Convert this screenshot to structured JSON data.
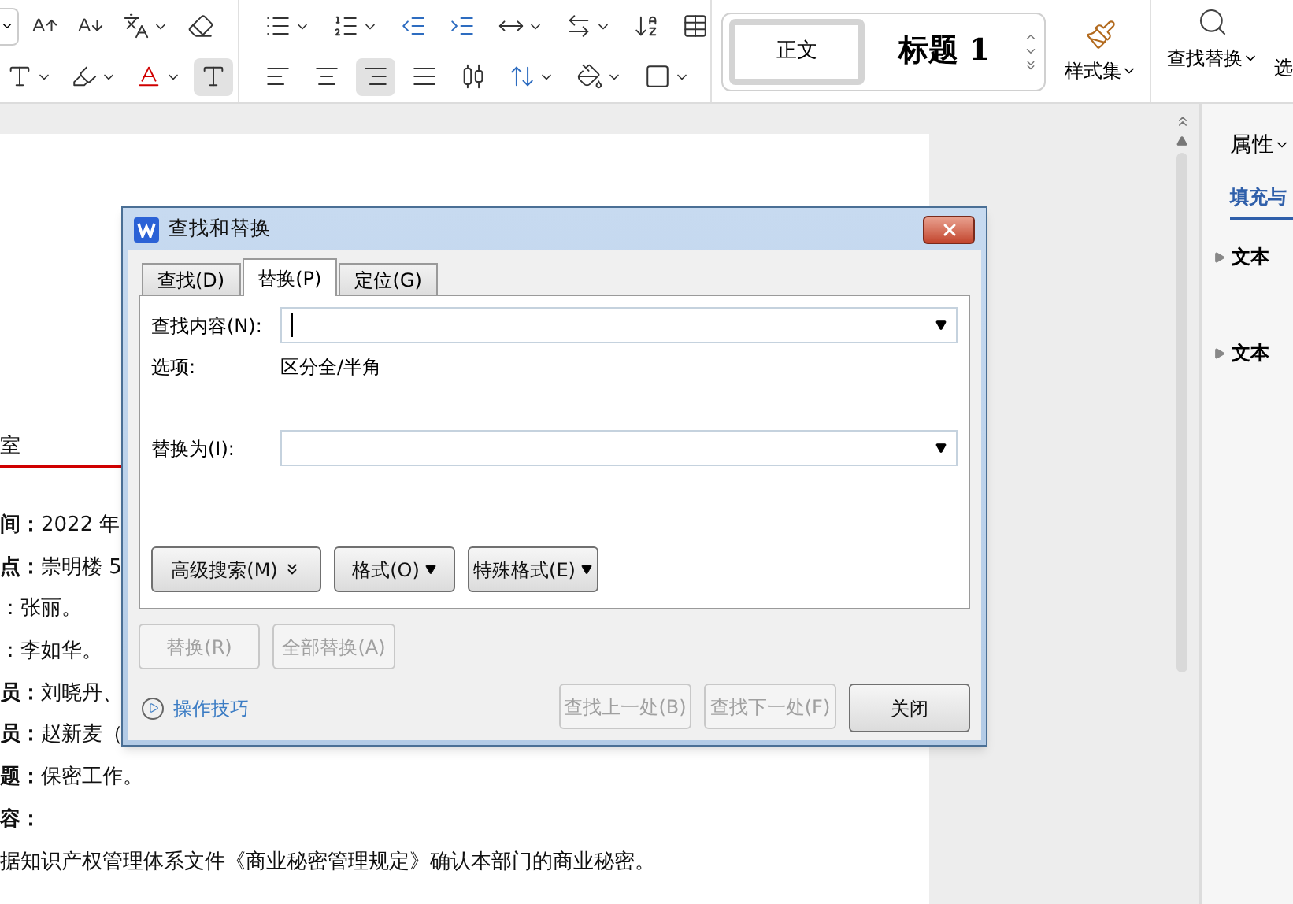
{
  "ribbon": {
    "style_gallery": [
      {
        "label": "正文",
        "selected": true
      },
      {
        "label": "标题 1",
        "selected": false
      }
    ],
    "style_set": "样式集",
    "find_replace": "查找替换",
    "next_tool": "选"
  },
  "document": {
    "heading": "室",
    "lines": [
      "**间：**2022 年",
      "**点：**崇明楼 5",
      "：张丽。",
      "：李如华。",
      "**员：**刘晓丹、",
      "**员：**赵新麦（",
      "**题：**保密工作。",
      "**容：**",
      "据知识产权管理体系文件《商业秘密管理规定》确认本部门的商业秘密。"
    ]
  },
  "dialog": {
    "title": "查找和替换",
    "tabs": [
      {
        "label": "查找(D)",
        "selected": false
      },
      {
        "label": "替换(P)",
        "selected": true
      },
      {
        "label": "定位(G)",
        "selected": false
      }
    ],
    "find_field": {
      "label": "查找内容(N):",
      "focused": true
    },
    "options_label": "选项:",
    "options_value": "区分全/半角",
    "replace_field": {
      "label": "替换为(I):",
      "focused": false
    },
    "panel_buttons": [
      {
        "label": "高级搜索(M)",
        "kind": "expand"
      },
      {
        "label": "格式(O)",
        "kind": "menu"
      },
      {
        "label": "特殊格式(E)",
        "kind": "menu"
      }
    ],
    "action_buttons": [
      {
        "label": "替换(R)",
        "disabled": true
      },
      {
        "label": "全部替换(A)",
        "disabled": true
      }
    ],
    "tips_link": "操作技巧",
    "nav_buttons": [
      {
        "label": "查找上一处(B)",
        "disabled": true
      },
      {
        "label": "查找下一处(F)",
        "disabled": true
      },
      {
        "label": "关闭",
        "disabled": false
      }
    ]
  },
  "properties_panel": {
    "title": "属性",
    "tabs": [
      {
        "label": "填充与",
        "selected": true
      }
    ],
    "sections": [
      {
        "label": "文本",
        "expanded": false
      },
      {
        "label": "文本",
        "expanded": false
      }
    ]
  }
}
